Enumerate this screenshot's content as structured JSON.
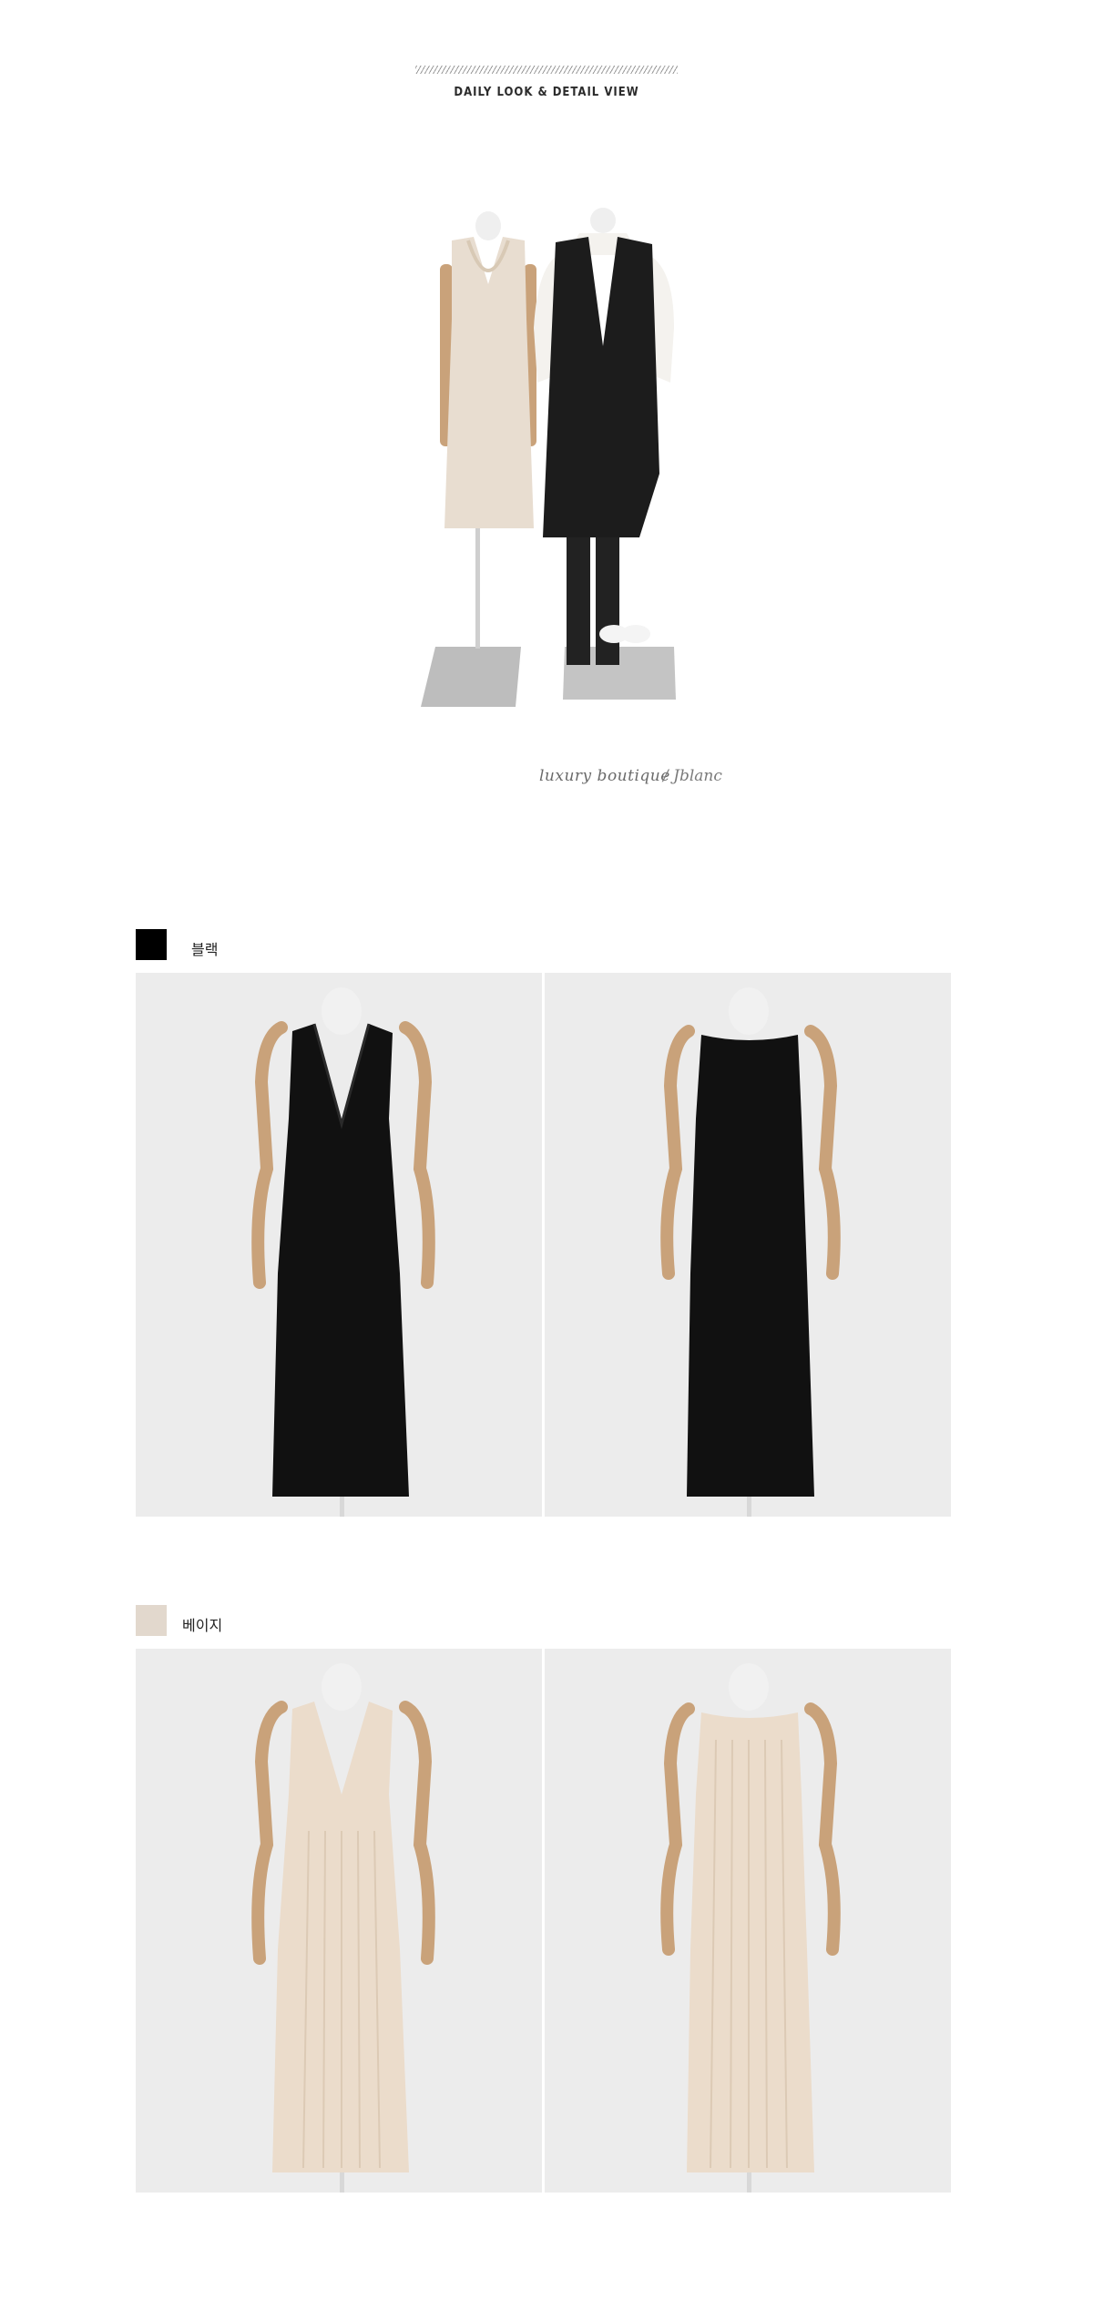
{
  "header": {
    "title": "DAILY LOOK & DETAIL VIEW"
  },
  "hero": {
    "tagline": "luxury boutique",
    "signature": "/ Jblanc"
  },
  "colors": {
    "black": {
      "label": "블랙",
      "swatch": "#000000",
      "dress": "#111111"
    },
    "beige": {
      "label": "베이지",
      "swatch": "#e2d8cd",
      "dress": "#ebdccb"
    },
    "photo_background": "#ededed",
    "wood": "#c9a27a"
  }
}
